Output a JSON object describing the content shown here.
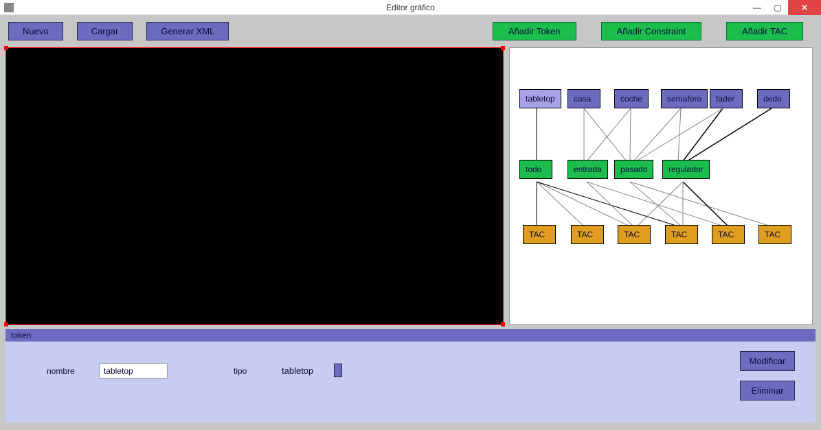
{
  "window": {
    "title": "Editor gráfico"
  },
  "toolbar": {
    "nuevo": "Nuevo",
    "cargar": "Cargar",
    "generar_xml": "Generar XML",
    "anadir_token": "Añadir Token",
    "anadir_constraint": "Añadir Constraint",
    "anadir_tac": "Añadir TAC"
  },
  "graph": {
    "tokens": [
      {
        "label": "tabletop",
        "selected": true
      },
      {
        "label": "casa"
      },
      {
        "label": "coche"
      },
      {
        "label": "semaforo"
      },
      {
        "label": "fader"
      },
      {
        "label": "dedo"
      }
    ],
    "constraints": [
      {
        "label": "todo"
      },
      {
        "label": "entrada"
      },
      {
        "label": "pasado"
      },
      {
        "label": "regulador"
      }
    ],
    "tacs": [
      {
        "label": "TAC"
      },
      {
        "label": "TAC"
      },
      {
        "label": "TAC"
      },
      {
        "label": "TAC"
      },
      {
        "label": "TAC"
      },
      {
        "label": "TAC"
      }
    ]
  },
  "properties": {
    "section_label": "token",
    "nombre_label": "nombre",
    "nombre_value": "tabletop",
    "tipo_label": "tipo",
    "tipo_value": "tabletop",
    "modificar": "Modificar",
    "eliminar": "Eliminar"
  }
}
